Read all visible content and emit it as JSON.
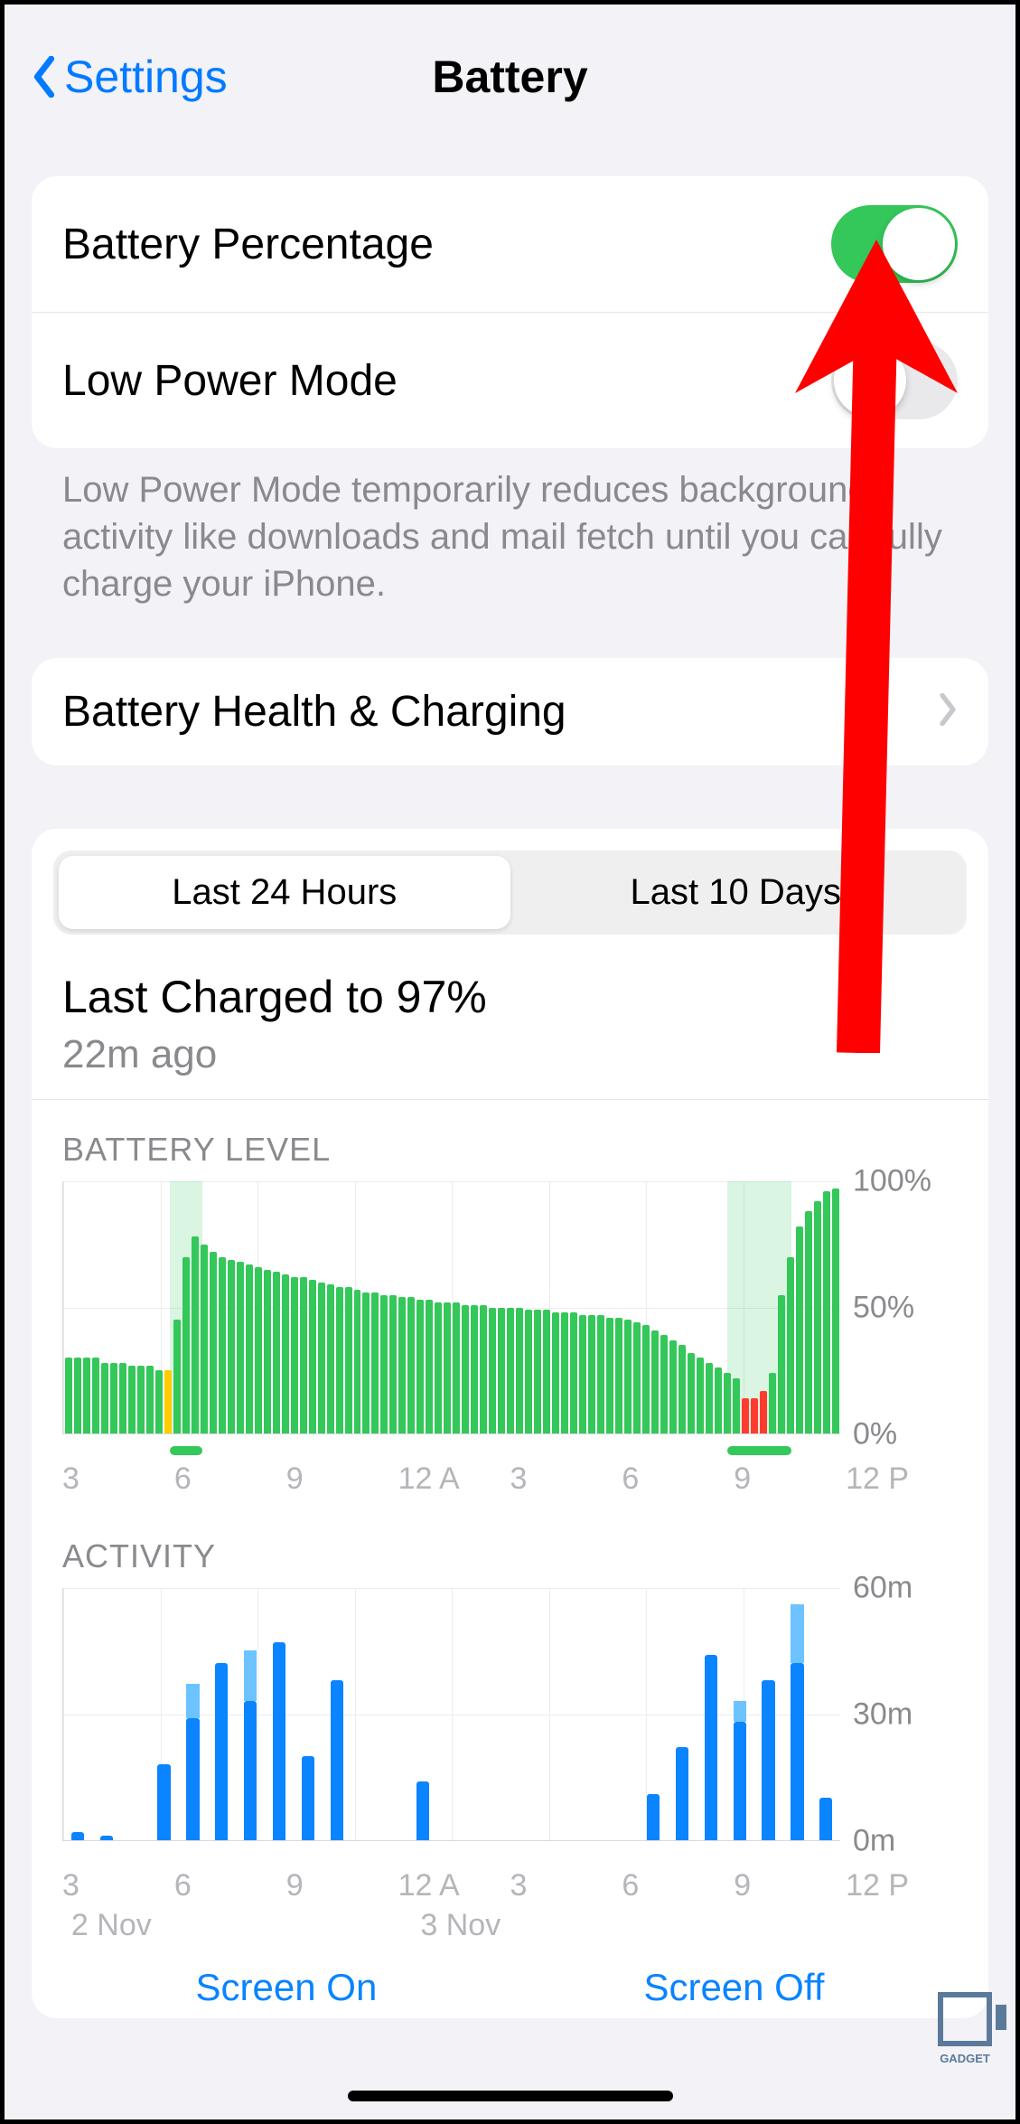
{
  "header": {
    "back_label": "Settings",
    "title": "Battery"
  },
  "toggles": {
    "battery_percentage": {
      "label": "Battery Percentage",
      "on": true
    },
    "low_power_mode": {
      "label": "Low Power Mode",
      "on": false
    },
    "low_power_footer": "Low Power Mode temporarily reduces background activity like downloads and mail fetch until you can fully charge your iPhone."
  },
  "health_row": {
    "label": "Battery Health & Charging"
  },
  "segmented": {
    "a": "Last 24 Hours",
    "b": "Last 10 Days",
    "selected": "a"
  },
  "last_charged": {
    "title": "Last Charged to 97%",
    "sub": "22m ago"
  },
  "battery_level_label": "BATTERY LEVEL",
  "activity_label": "ACTIVITY",
  "legend": {
    "on": "Screen On",
    "off": "Screen Off"
  },
  "date_a": "2 Nov",
  "date_b": "3 Nov",
  "watermark": "GADGET",
  "chart_data": [
    {
      "type": "bar",
      "title": "BATTERY LEVEL",
      "ylabel": "%",
      "ylim": [
        0,
        100
      ],
      "y_ticks": [
        0,
        50,
        100
      ],
      "x_ticks": [
        "3",
        "6",
        "9",
        "12 A",
        "3",
        "6",
        "9",
        "12 P"
      ],
      "charging_bands": [
        [
          3.3,
          4.3
        ],
        [
          20.5,
          22.5
        ]
      ],
      "values": [
        30,
        30,
        30,
        30,
        28,
        28,
        28,
        27,
        27,
        27,
        25,
        25,
        45,
        70,
        78,
        75,
        72,
        70,
        69,
        68,
        67,
        66,
        65,
        64,
        63,
        62,
        62,
        61,
        60,
        59,
        58,
        58,
        57,
        56,
        56,
        55,
        55,
        54,
        54,
        53,
        53,
        52,
        52,
        52,
        51,
        51,
        51,
        50,
        50,
        50,
        50,
        49,
        49,
        49,
        48,
        48,
        48,
        47,
        47,
        47,
        46,
        46,
        45,
        44,
        43,
        41,
        39,
        37,
        35,
        32,
        30,
        28,
        26,
        24,
        22,
        14,
        14,
        17,
        24,
        55,
        70,
        82,
        88,
        92,
        96,
        97
      ],
      "low_threshold": 20,
      "yellow_indices": [
        11
      ]
    },
    {
      "type": "bar",
      "title": "ACTIVITY",
      "ylabel": "minutes",
      "ylim": [
        0,
        60
      ],
      "y_ticks": [
        0,
        30,
        60
      ],
      "x_ticks": [
        "3",
        "6",
        "9",
        "12 A",
        "3",
        "6",
        "9",
        "12 P"
      ],
      "series": [
        {
          "name": "Screen On",
          "values": [
            2,
            1,
            0,
            18,
            29,
            42,
            33,
            47,
            20,
            38,
            0,
            0,
            14,
            0,
            0,
            0,
            0,
            0,
            0,
            0,
            11,
            22,
            44,
            28,
            38,
            42,
            10
          ]
        },
        {
          "name": "Screen Off",
          "values": [
            0,
            0,
            0,
            0,
            8,
            0,
            12,
            0,
            0,
            0,
            0,
            0,
            0,
            0,
            0,
            0,
            0,
            0,
            0,
            0,
            0,
            0,
            0,
            5,
            0,
            14,
            0
          ]
        }
      ],
      "date_labels": [
        "2 Nov",
        "3 Nov"
      ]
    }
  ]
}
